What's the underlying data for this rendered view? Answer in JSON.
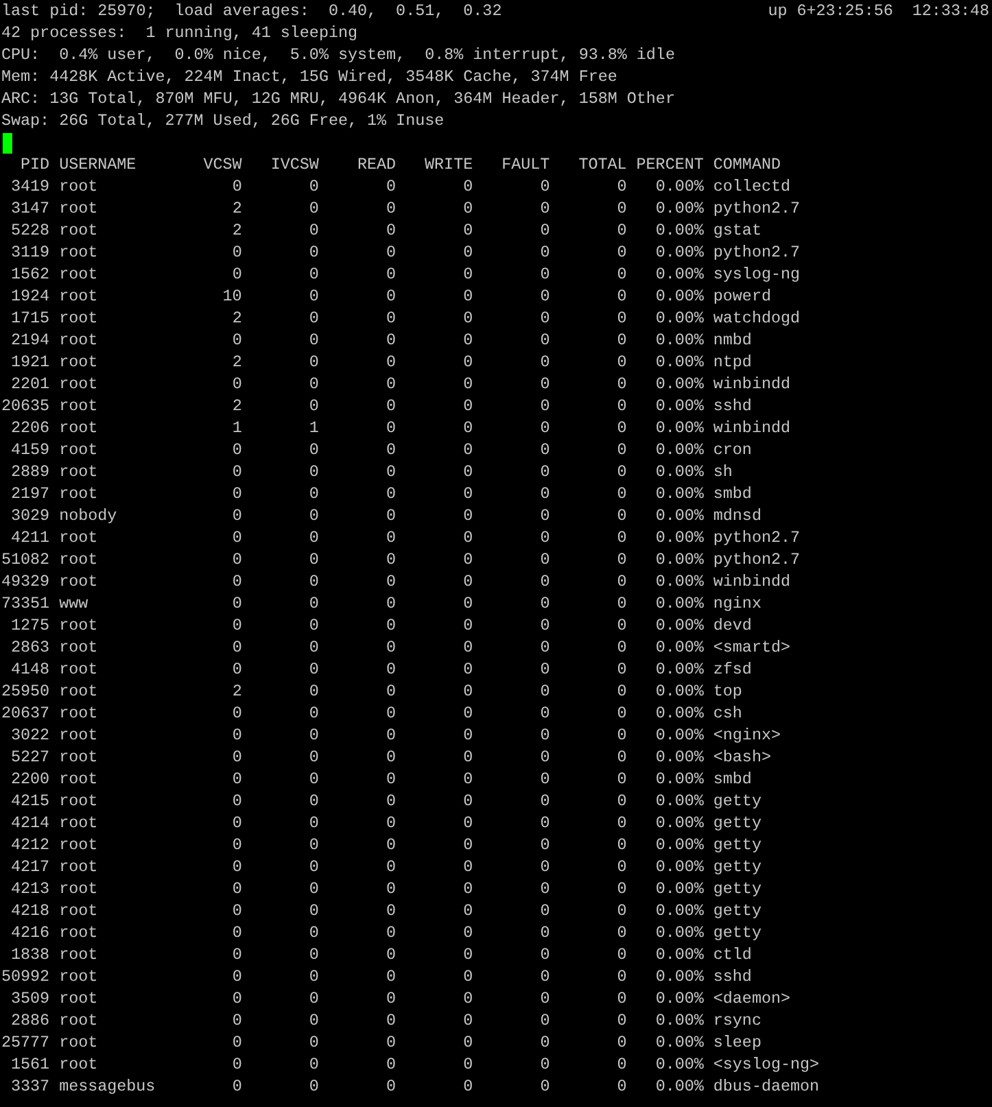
{
  "summary": {
    "load_line": "last pid: 25970;  load averages:  0.40,  0.51,  0.32",
    "uptime": "up 6+23:25:56",
    "clock": "12:33:48",
    "lines": [
      "42 processes:  1 running, 41 sleeping",
      "CPU:  0.4% user,  0.0% nice,  5.0% system,  0.8% interrupt, 93.8% idle",
      "Mem: 4428K Active, 224M Inact, 15G Wired, 3548K Cache, 374M Free",
      "ARC: 13G Total, 870M MFU, 12G MRU, 4964K Anon, 364M Header, 158M Other",
      "Swap: 26G Total, 277M Used, 26G Free, 1% Inuse"
    ]
  },
  "table": {
    "columns": [
      "PID",
      "USERNAME",
      "VCSW",
      "IVCSW",
      "READ",
      "WRITE",
      "FAULT",
      "TOTAL",
      "PERCENT",
      "COMMAND"
    ],
    "rows": [
      [
        "3419",
        "root",
        "0",
        "0",
        "0",
        "0",
        "0",
        "0",
        "0.00%",
        "collectd"
      ],
      [
        "3147",
        "root",
        "2",
        "0",
        "0",
        "0",
        "0",
        "0",
        "0.00%",
        "python2.7"
      ],
      [
        "5228",
        "root",
        "2",
        "0",
        "0",
        "0",
        "0",
        "0",
        "0.00%",
        "gstat"
      ],
      [
        "3119",
        "root",
        "0",
        "0",
        "0",
        "0",
        "0",
        "0",
        "0.00%",
        "python2.7"
      ],
      [
        "1562",
        "root",
        "0",
        "0",
        "0",
        "0",
        "0",
        "0",
        "0.00%",
        "syslog-ng"
      ],
      [
        "1924",
        "root",
        "10",
        "0",
        "0",
        "0",
        "0",
        "0",
        "0.00%",
        "powerd"
      ],
      [
        "1715",
        "root",
        "2",
        "0",
        "0",
        "0",
        "0",
        "0",
        "0.00%",
        "watchdogd"
      ],
      [
        "2194",
        "root",
        "0",
        "0",
        "0",
        "0",
        "0",
        "0",
        "0.00%",
        "nmbd"
      ],
      [
        "1921",
        "root",
        "2",
        "0",
        "0",
        "0",
        "0",
        "0",
        "0.00%",
        "ntpd"
      ],
      [
        "2201",
        "root",
        "0",
        "0",
        "0",
        "0",
        "0",
        "0",
        "0.00%",
        "winbindd"
      ],
      [
        "20635",
        "root",
        "2",
        "0",
        "0",
        "0",
        "0",
        "0",
        "0.00%",
        "sshd"
      ],
      [
        "2206",
        "root",
        "1",
        "1",
        "0",
        "0",
        "0",
        "0",
        "0.00%",
        "winbindd"
      ],
      [
        "4159",
        "root",
        "0",
        "0",
        "0",
        "0",
        "0",
        "0",
        "0.00%",
        "cron"
      ],
      [
        "2889",
        "root",
        "0",
        "0",
        "0",
        "0",
        "0",
        "0",
        "0.00%",
        "sh"
      ],
      [
        "2197",
        "root",
        "0",
        "0",
        "0",
        "0",
        "0",
        "0",
        "0.00%",
        "smbd"
      ],
      [
        "3029",
        "nobody",
        "0",
        "0",
        "0",
        "0",
        "0",
        "0",
        "0.00%",
        "mdnsd"
      ],
      [
        "4211",
        "root",
        "0",
        "0",
        "0",
        "0",
        "0",
        "0",
        "0.00%",
        "python2.7"
      ],
      [
        "51082",
        "root",
        "0",
        "0",
        "0",
        "0",
        "0",
        "0",
        "0.00%",
        "python2.7"
      ],
      [
        "49329",
        "root",
        "0",
        "0",
        "0",
        "0",
        "0",
        "0",
        "0.00%",
        "winbindd"
      ],
      [
        "73351",
        "www",
        "0",
        "0",
        "0",
        "0",
        "0",
        "0",
        "0.00%",
        "nginx"
      ],
      [
        "1275",
        "root",
        "0",
        "0",
        "0",
        "0",
        "0",
        "0",
        "0.00%",
        "devd"
      ],
      [
        "2863",
        "root",
        "0",
        "0",
        "0",
        "0",
        "0",
        "0",
        "0.00%",
        "<smartd>"
      ],
      [
        "4148",
        "root",
        "0",
        "0",
        "0",
        "0",
        "0",
        "0",
        "0.00%",
        "zfsd"
      ],
      [
        "25950",
        "root",
        "2",
        "0",
        "0",
        "0",
        "0",
        "0",
        "0.00%",
        "top"
      ],
      [
        "20637",
        "root",
        "0",
        "0",
        "0",
        "0",
        "0",
        "0",
        "0.00%",
        "csh"
      ],
      [
        "3022",
        "root",
        "0",
        "0",
        "0",
        "0",
        "0",
        "0",
        "0.00%",
        "<nginx>"
      ],
      [
        "5227",
        "root",
        "0",
        "0",
        "0",
        "0",
        "0",
        "0",
        "0.00%",
        "<bash>"
      ],
      [
        "2200",
        "root",
        "0",
        "0",
        "0",
        "0",
        "0",
        "0",
        "0.00%",
        "smbd"
      ],
      [
        "4215",
        "root",
        "0",
        "0",
        "0",
        "0",
        "0",
        "0",
        "0.00%",
        "getty"
      ],
      [
        "4214",
        "root",
        "0",
        "0",
        "0",
        "0",
        "0",
        "0",
        "0.00%",
        "getty"
      ],
      [
        "4212",
        "root",
        "0",
        "0",
        "0",
        "0",
        "0",
        "0",
        "0.00%",
        "getty"
      ],
      [
        "4217",
        "root",
        "0",
        "0",
        "0",
        "0",
        "0",
        "0",
        "0.00%",
        "getty"
      ],
      [
        "4213",
        "root",
        "0",
        "0",
        "0",
        "0",
        "0",
        "0",
        "0.00%",
        "getty"
      ],
      [
        "4218",
        "root",
        "0",
        "0",
        "0",
        "0",
        "0",
        "0",
        "0.00%",
        "getty"
      ],
      [
        "4216",
        "root",
        "0",
        "0",
        "0",
        "0",
        "0",
        "0",
        "0.00%",
        "getty"
      ],
      [
        "1838",
        "root",
        "0",
        "0",
        "0",
        "0",
        "0",
        "0",
        "0.00%",
        "ctld"
      ],
      [
        "50992",
        "root",
        "0",
        "0",
        "0",
        "0",
        "0",
        "0",
        "0.00%",
        "sshd"
      ],
      [
        "3509",
        "root",
        "0",
        "0",
        "0",
        "0",
        "0",
        "0",
        "0.00%",
        "<daemon>"
      ],
      [
        "2886",
        "root",
        "0",
        "0",
        "0",
        "0",
        "0",
        "0",
        "0.00%",
        "rsync"
      ],
      [
        "25777",
        "root",
        "0",
        "0",
        "0",
        "0",
        "0",
        "0",
        "0.00%",
        "sleep"
      ],
      [
        "1561",
        "root",
        "0",
        "0",
        "0",
        "0",
        "0",
        "0",
        "0.00%",
        "<syslog-ng>"
      ],
      [
        "3337",
        "messagebus",
        "0",
        "0",
        "0",
        "0",
        "0",
        "0",
        "0.00%",
        "dbus-daemon"
      ]
    ]
  }
}
